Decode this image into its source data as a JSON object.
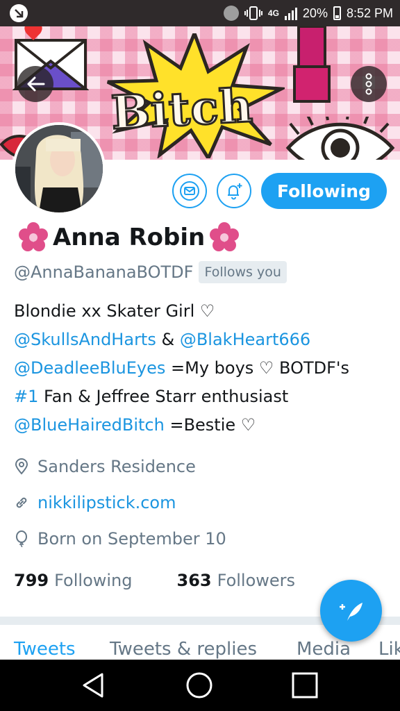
{
  "status_bar": {
    "app_icon": "twitter-notification-icon",
    "bluetooth_icon": "bluetooth-icon",
    "vibrate_icon": "vibrate-icon",
    "network": "4G",
    "battery": "20%",
    "time": "8:52 PM"
  },
  "header": {
    "banner_text": "Bitch",
    "back_icon": "arrow-left-icon",
    "more_icon": "vertical-dots-icon"
  },
  "profile": {
    "name": "Anna Robin",
    "handle": "@AnnaBananaBOTDF",
    "follows_you": "Follows you",
    "following_button": "Following",
    "bio": {
      "line1": "Blondie xx Skater Girl ♡",
      "mention1": "@SkullsAndHarts",
      "amp": " & ",
      "mention2": "@BlakHeart666",
      "mention3": "@DeadleeBluEyes",
      "line3_rest": " =My boys ♡ BOTDF's",
      "hashtag": "#1",
      "line4_rest": " Fan & Jeffree Starr enthusiast",
      "mention4": "@BlueHairedBitch",
      "line5_rest": " =Bestie ♡"
    },
    "location": "Sanders Residence",
    "website": "nikkilipstick.com",
    "birthday": "Born on September 10",
    "following_count": "799",
    "following_label": "Following",
    "followers_count": "363",
    "followers_label": "Followers"
  },
  "tabs": [
    "Tweets",
    "Tweets & replies",
    "Media",
    "Likes"
  ],
  "colors": {
    "accent": "#1da1f2",
    "link": "#1b95e0",
    "muted": "#657786"
  }
}
